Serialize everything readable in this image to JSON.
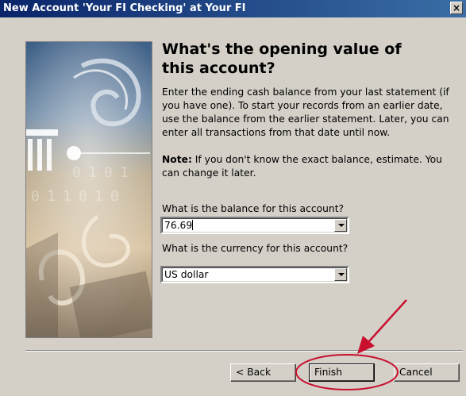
{
  "window": {
    "title": "New Account 'Your FI Checking' at Your FI",
    "close_label": "×"
  },
  "content": {
    "heading": "What's the opening value of this account?",
    "intro": "Enter the ending cash balance from your last statement (if you have one). To start your records from an earlier date, use the balance from the earlier statement. Later, you can enter all transactions from that date until now.",
    "note_label": "Note:",
    "note_text": " If you don't know the exact balance, estimate. You can change it later."
  },
  "balance": {
    "label": "What is the balance for this account?",
    "value": "76.69"
  },
  "currency": {
    "label": "What is the currency for this account?",
    "value": "US dollar"
  },
  "buttons": {
    "back": "< Back",
    "finish": "Finish",
    "cancel": "Cancel"
  },
  "illustration": {
    "digits": [
      "0",
      "1",
      "0",
      "1",
      "0",
      "1",
      "1",
      "0",
      "1",
      "0"
    ]
  },
  "colors": {
    "title_bar": "#0a246a",
    "dialog_face": "#d4d0c8",
    "annotation": "#c8102e"
  }
}
